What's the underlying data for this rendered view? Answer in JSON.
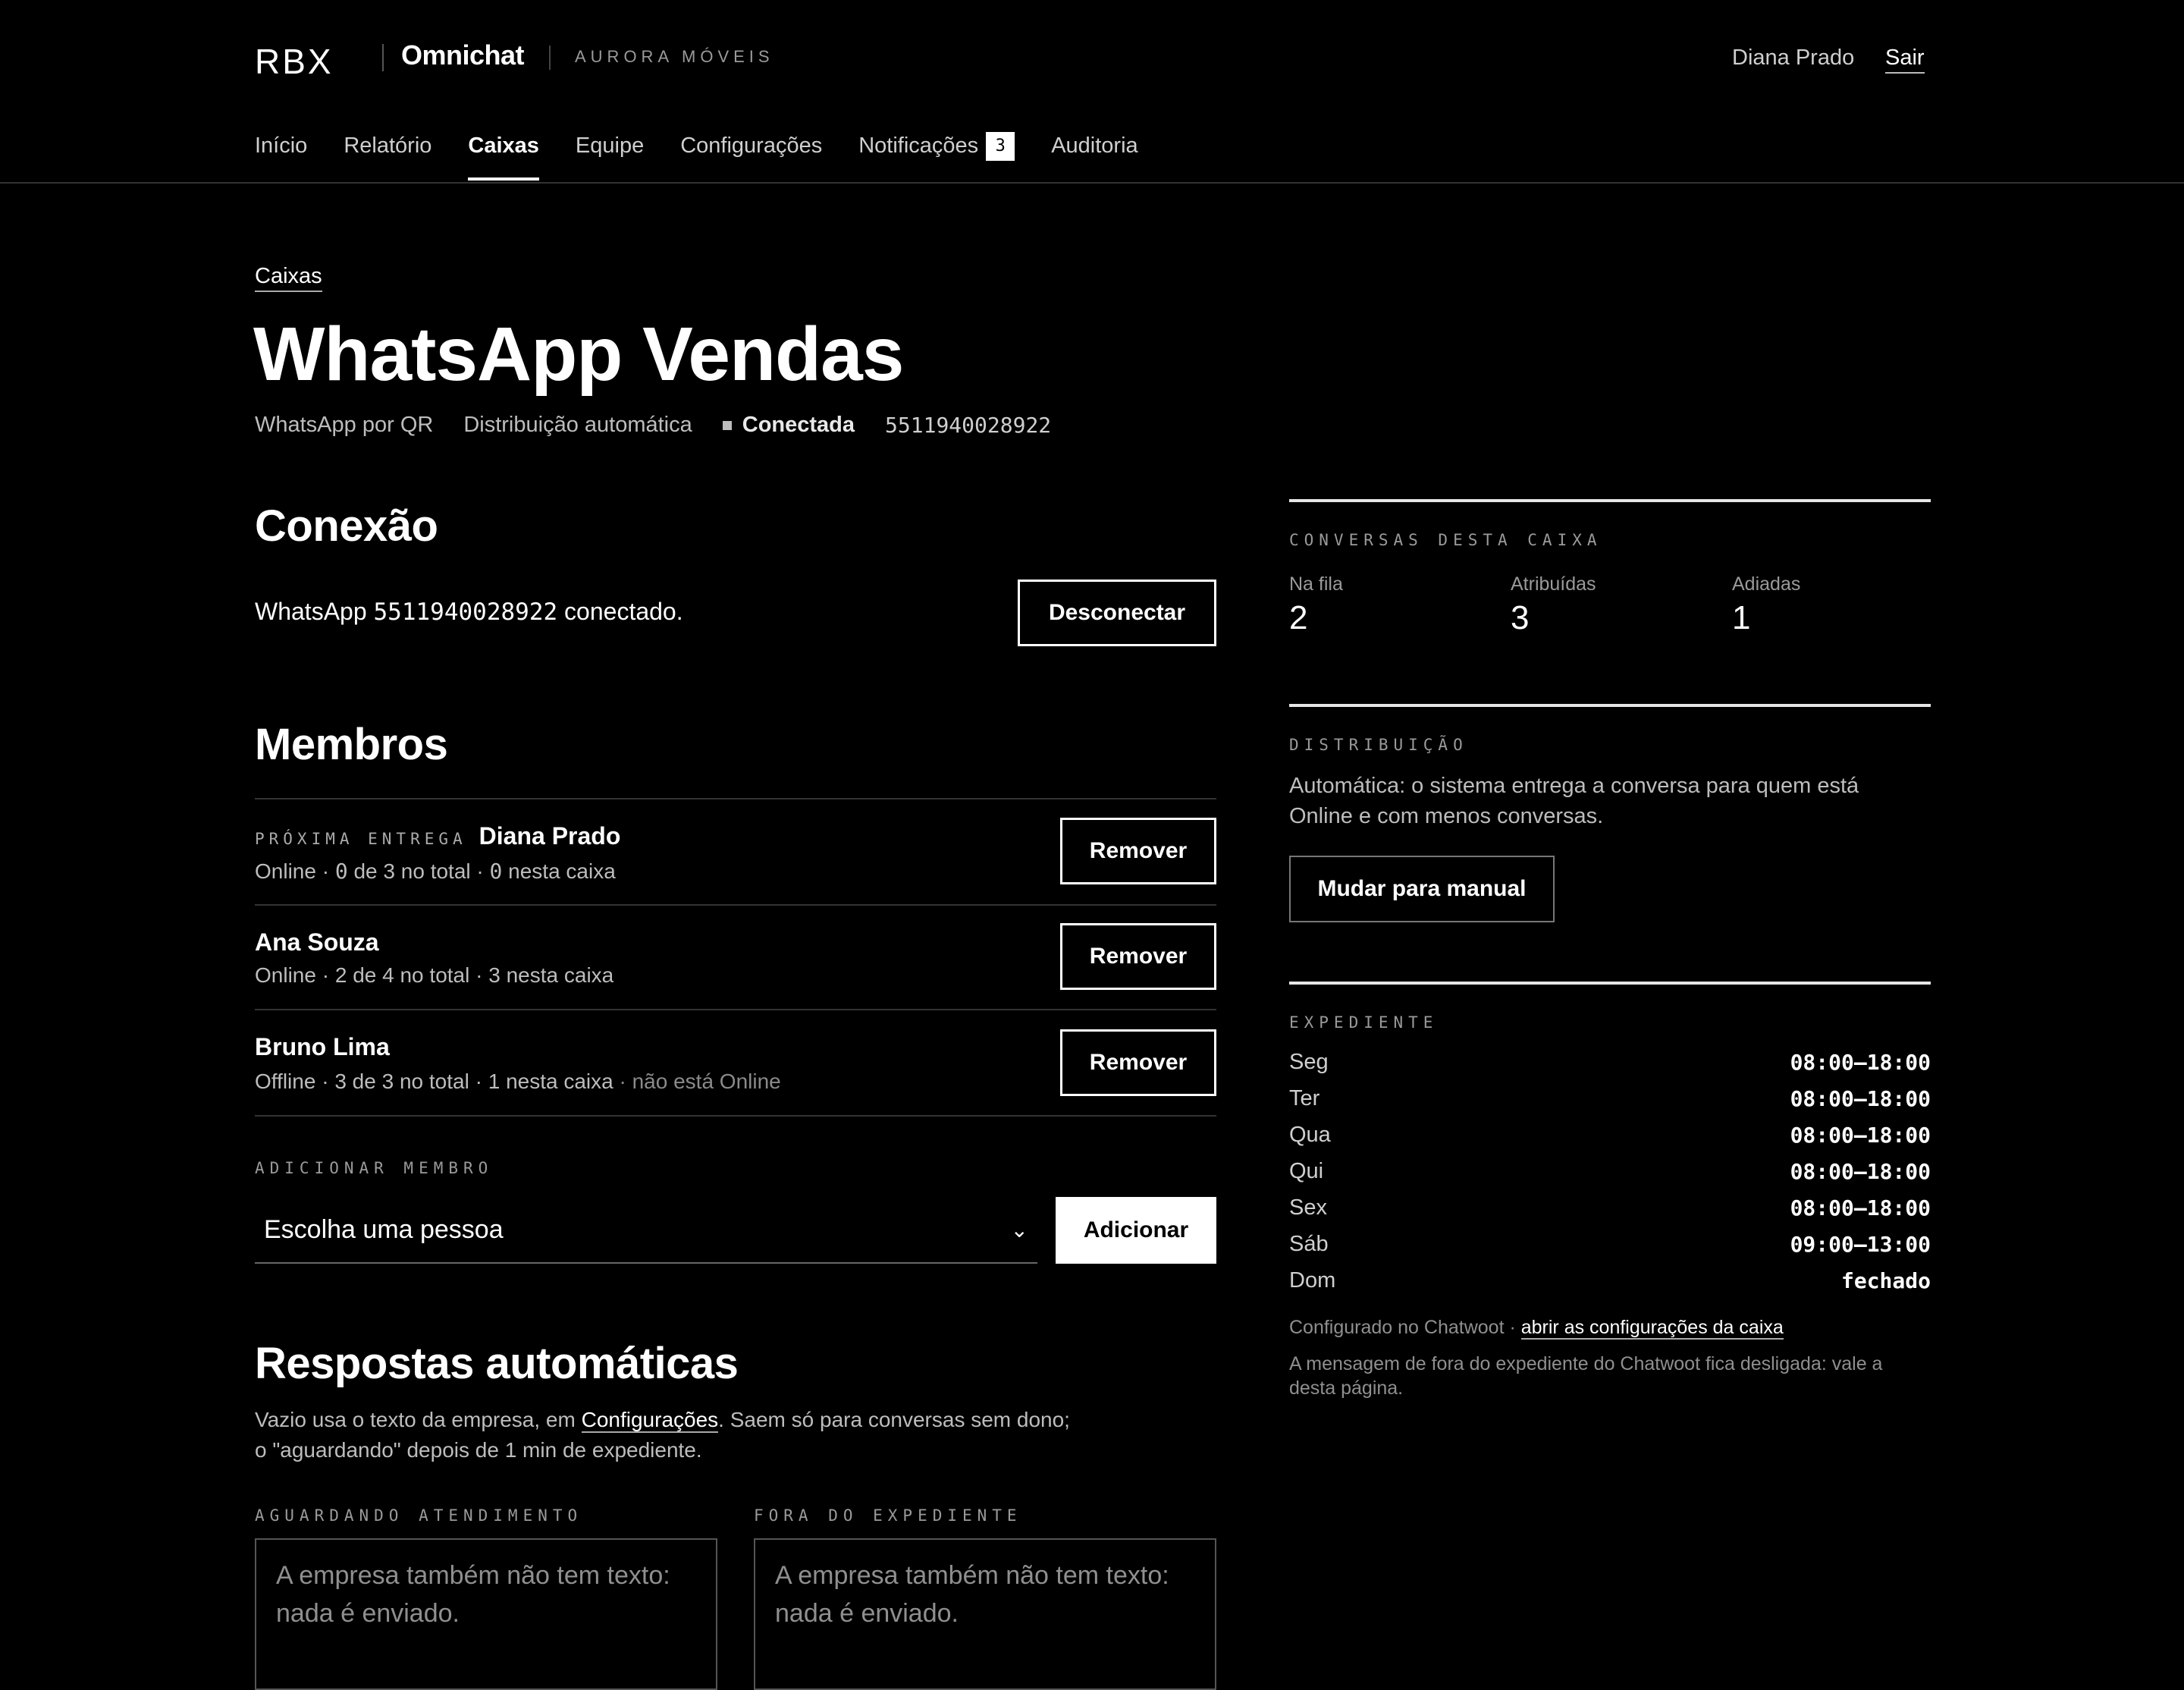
{
  "header": {
    "logo": "RBX",
    "app_name": "Omnichat",
    "company": "AURORA MÓVEIS",
    "user_name": "Diana Prado",
    "logout_label": "Sair"
  },
  "nav": {
    "items": [
      {
        "label": "Início"
      },
      {
        "label": "Relatório"
      },
      {
        "label": "Caixas"
      },
      {
        "label": "Equipe"
      },
      {
        "label": "Configurações"
      },
      {
        "label": "Notificações",
        "badge": "3"
      },
      {
        "label": "Auditoria"
      }
    ],
    "active": "Caixas"
  },
  "breadcrumb": "Caixas",
  "page": {
    "title": "WhatsApp Vendas",
    "channel": "WhatsApp por QR",
    "distribution_mode": "Distribuição automática",
    "status": "Conectada",
    "phone": "5511940028922"
  },
  "connection": {
    "heading": "Conexão",
    "text_prefix": "WhatsApp",
    "phone": "5511940028922",
    "text_suffix": "conectado.",
    "disconnect_label": "Desconectar"
  },
  "members": {
    "heading": "Membros",
    "next_label": "PRÓXIMA ENTREGA",
    "remove_label": "Remover",
    "list": [
      {
        "name": "Diana Prado",
        "status": "Online",
        "current": "0",
        "of": "de",
        "max": "3",
        "total_label": "no total",
        "inbox": "0",
        "inbox_label": "nesta caixa",
        "note": ""
      },
      {
        "name": "Ana Souza",
        "status": "Online",
        "current": "2",
        "of": "de",
        "max": "4",
        "total_label": "no total",
        "inbox": "3",
        "inbox_label": "nesta caixa",
        "note": ""
      },
      {
        "name": "Bruno Lima",
        "status": "Offline",
        "current": "3",
        "of": "de",
        "max": "3",
        "total_label": "no total",
        "inbox": "1",
        "inbox_label": "nesta caixa",
        "note": "· não está Online"
      }
    ],
    "add_label": "ADICIONAR MEMBRO",
    "select_placeholder": "Escolha uma pessoa",
    "add_button": "Adicionar"
  },
  "auto_replies": {
    "heading": "Respostas automáticas",
    "desc_part1": "Vazio usa o texto da empresa, em",
    "desc_link": "Configurações",
    "desc_part2": ". Saem só para conversas sem dono; o \"aguardando\" depois de 1 min de expediente.",
    "waiting_label": "AGUARDANDO ATENDIMENTO",
    "waiting_placeholder": "A empresa também não tem texto: nada é enviado.",
    "offhours_label": "FORA DO EXPEDIENTE",
    "offhours_placeholder": "A empresa também não tem texto: nada é enviado."
  },
  "sidebar": {
    "stats_label": "CONVERSAS DESTA CAIXA",
    "stats": [
      {
        "label": "Na fila",
        "value": "2"
      },
      {
        "label": "Atribuídas",
        "value": "3"
      },
      {
        "label": "Adiadas",
        "value": "1"
      }
    ],
    "distribution_label": "DISTRIBUIÇÃO",
    "distribution_text": "Automática: o sistema entrega a conversa para quem está Online e com menos conversas.",
    "switch_button": "Mudar para manual",
    "hours_label": "EXPEDIENTE",
    "hours": [
      {
        "day": "Seg",
        "time": "08:00–18:00"
      },
      {
        "day": "Ter",
        "time": "08:00–18:00"
      },
      {
        "day": "Qua",
        "time": "08:00–18:00"
      },
      {
        "day": "Qui",
        "time": "08:00–18:00"
      },
      {
        "day": "Sex",
        "time": "08:00–18:00"
      },
      {
        "day": "Sáb",
        "time": "09:00–13:00"
      },
      {
        "day": "Dom",
        "time": "fechado"
      }
    ],
    "configured_prefix": "Configurado no Chatwoot ·",
    "configured_link": "abrir as configurações da caixa",
    "offhours_note": "A mensagem de fora do expediente do Chatwoot fica desligada: vale a desta página."
  }
}
